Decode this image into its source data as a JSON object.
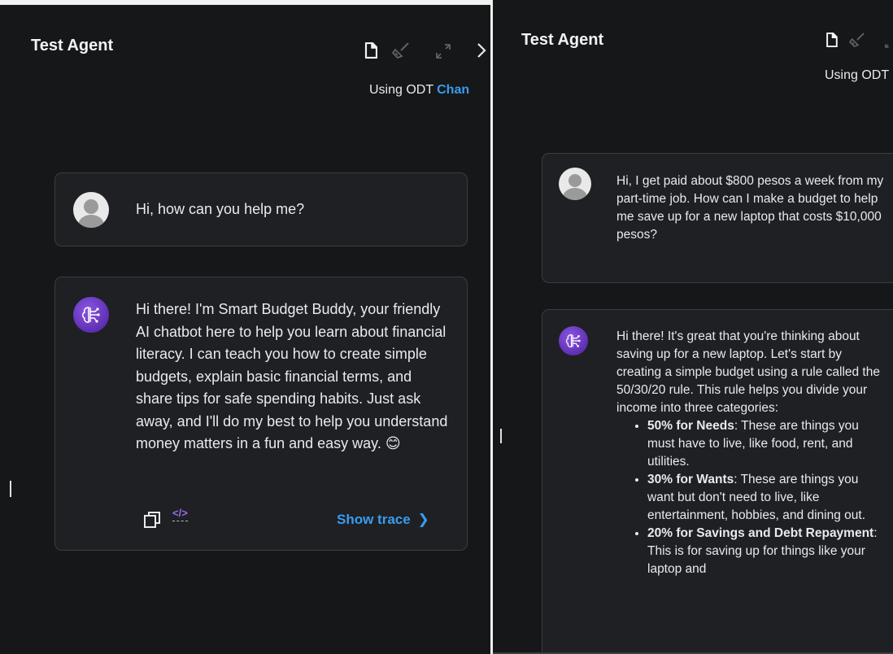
{
  "colors": {
    "background": "#161718",
    "card": "#1e2023",
    "border": "#3a3d42",
    "link": "#3a9cf0",
    "text": "#e8eaed"
  },
  "icons": [
    "document-icon",
    "broom-icon",
    "expand-icon",
    "chevron-right-icon",
    "copy-icon",
    "code-icon"
  ],
  "left_panel": {
    "title": "Test Agent",
    "using_label": "Using ODT",
    "change_link": "Chan",
    "user_message": "Hi, how can you help me?",
    "bot_message": "Hi there! I'm Smart Budget Buddy, your friendly AI chatbot here to help you learn about financial literacy. I can teach you how to create simple budgets, explain basic financial terms, and share tips for safe spending habits. Just ask away, and I'll do my best to help you understand money matters in a fun and easy way. 😊",
    "code_icon_text": "</>",
    "show_trace": "Show trace",
    "show_trace_chevron": "❯"
  },
  "right_panel": {
    "title": "Test Agent",
    "using_label": "Using ODT",
    "user_message": "Hi, I get paid about $800 pesos a week from my part-time job. How can I make a budget to help me save up for a new laptop that costs $10,000 pesos?",
    "bot_intro": "Hi there! It's great that you're thinking about saving up for a new laptop. Let's start by creating a simple budget using a rule called the 50/30/20 rule. This rule helps you divide your income into three categories:",
    "bullets": [
      {
        "term": "50% for Needs",
        "text": ": These are things you must have to live, like food, rent, and utilities."
      },
      {
        "term": "30% for Wants",
        "text": ": These are things you want but don't need to live, like entertainment, hobbies, and dining out."
      },
      {
        "term": "20% for Savings and Debt Repayment",
        "text": ": This is for saving up for things like your laptop and"
      }
    ]
  }
}
